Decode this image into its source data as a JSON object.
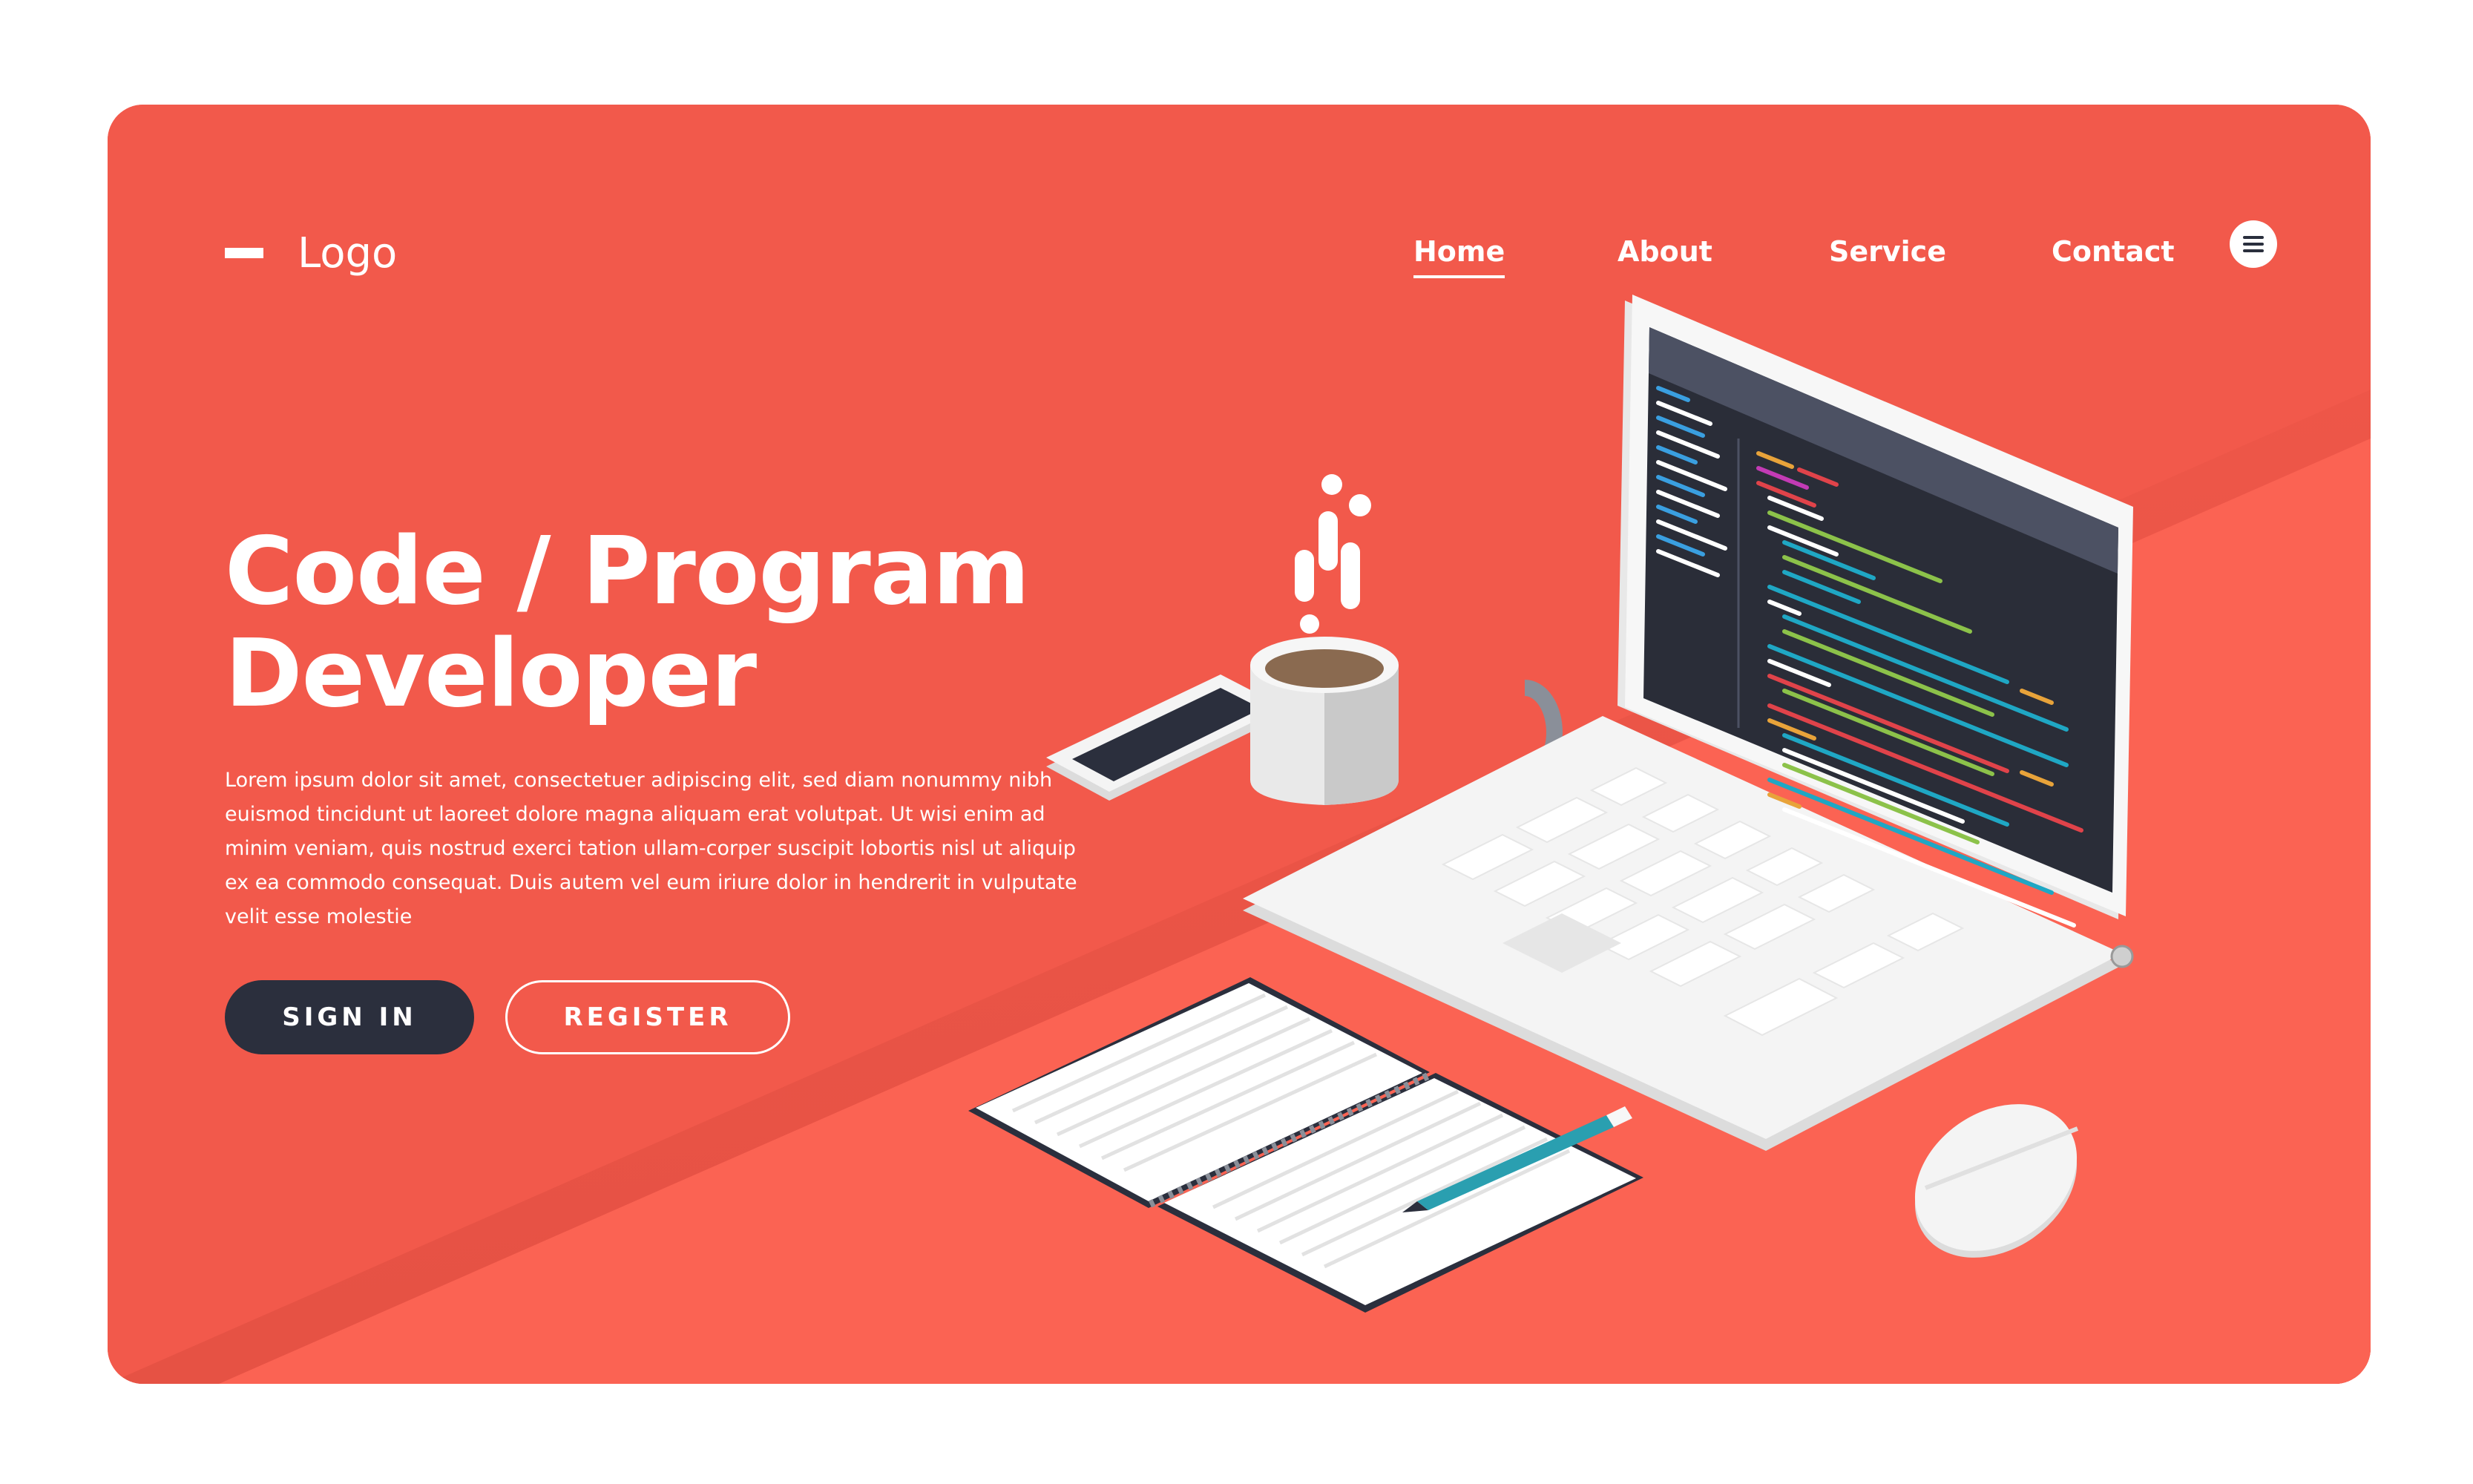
{
  "header": {
    "logo_text": "Logo",
    "nav": [
      {
        "label": "Home",
        "active": true
      },
      {
        "label": "About",
        "active": false
      },
      {
        "label": "Service",
        "active": false
      },
      {
        "label": "Contact",
        "active": false
      }
    ],
    "menu_icon": "hamburger-menu-icon"
  },
  "hero": {
    "title_line1": "Code / Program",
    "title_line2": "Developer",
    "description": "Lorem ipsum dolor sit amet, consectetuer adipiscing elit, sed diam nonummy nibh euismod tincidunt ut laoreet dolore magna aliquam erat volutpat. Ut wisi enim ad minim veniam, quis nostrud exerci tation ullam-corper suscipit lobortis nisl ut aliquip ex ea commodo consequat. Duis autem vel eum iriure dolor in hendrerit in vulputate velit esse molestie"
  },
  "buttons": {
    "signin": "SIGN IN",
    "register": "REGISTER"
  },
  "illustration": {
    "items": [
      "laptop-icon",
      "code-editor-screen",
      "coffee-mug-icon",
      "smartphone-icon",
      "notebook-icon",
      "pencil-icon",
      "mouse-icon"
    ]
  },
  "colors": {
    "background": "#f2594b",
    "floor": "#fb6353",
    "button_dark": "#2b2f3d",
    "screen": "#2a2d38",
    "screen_bar": "#4c5163"
  }
}
